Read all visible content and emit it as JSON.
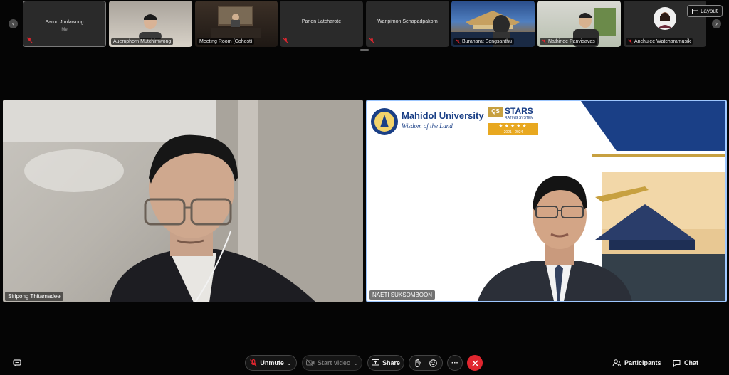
{
  "strip": {
    "participants": [
      {
        "name": "Sarun Junlawong",
        "sub": "Me"
      },
      {
        "name": "Auemphorn Mutchimwong"
      },
      {
        "name": "Meeting Room (Cohost)"
      },
      {
        "name": "Panon Latcharote"
      },
      {
        "name": "Wanpimon Senapadpakorn"
      },
      {
        "name": "Buranarat Songsanthu"
      },
      {
        "name": "Nathinee Panvisavas"
      },
      {
        "name": "Anchulee Watcharamusik"
      }
    ]
  },
  "layout_label": "Layout",
  "main": {
    "left_name": "Siripong Thitamadee",
    "right_name": "NAETI SUKSOMBOON",
    "slide": {
      "university": "Mahidol University",
      "tagline": "Wisdom of the Land",
      "qs_badge": "QS",
      "stars_title": "STARS",
      "stars_sub": "RATING SYSTEM",
      "stars_years": "2021 - 2024"
    }
  },
  "toolbar": {
    "unmute": "Unmute",
    "start_video": "Start video",
    "share": "Share",
    "participants": "Participants",
    "chat": "Chat"
  },
  "colors": {
    "accent": "#9ec7ff",
    "leave": "#e0262f",
    "mute": "#e0262f"
  }
}
